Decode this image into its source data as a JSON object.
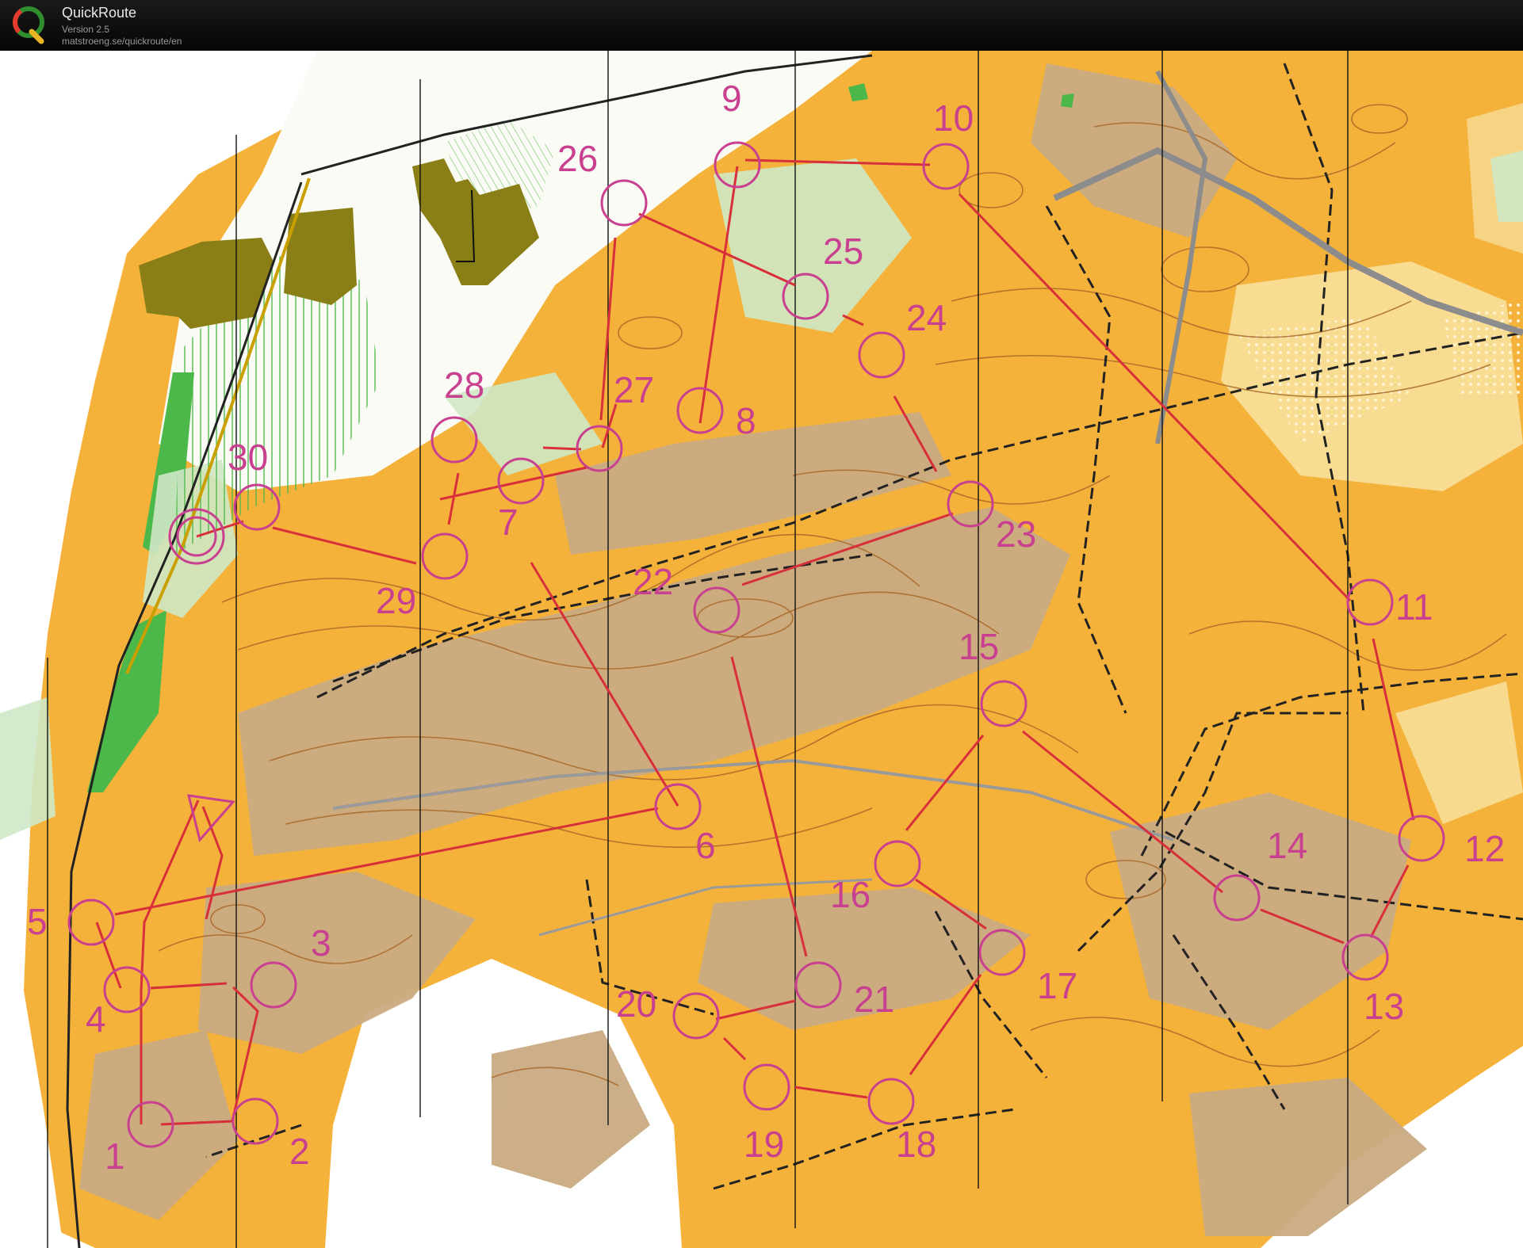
{
  "app": {
    "title": "QuickRoute",
    "version": "Version 2.5",
    "url": "matstroeng.se/quickroute/en"
  },
  "colors": {
    "course": "#c8408f",
    "route": "#d8303a",
    "open_land": "#f4b23a",
    "rough_open": "#c9ab82",
    "forest": "#ffffff",
    "green": "#4cb84a",
    "building": "#8a7f16",
    "contour": "#a8692a"
  },
  "course": {
    "start_label": "",
    "controls": [
      "1",
      "2",
      "3",
      "4",
      "5",
      "6",
      "7",
      "8",
      "9",
      "10",
      "11",
      "12",
      "13",
      "14",
      "15",
      "16",
      "17",
      "18",
      "19",
      "20",
      "21",
      "22",
      "23",
      "24",
      "25",
      "26",
      "27",
      "28",
      "29",
      "30"
    ]
  }
}
